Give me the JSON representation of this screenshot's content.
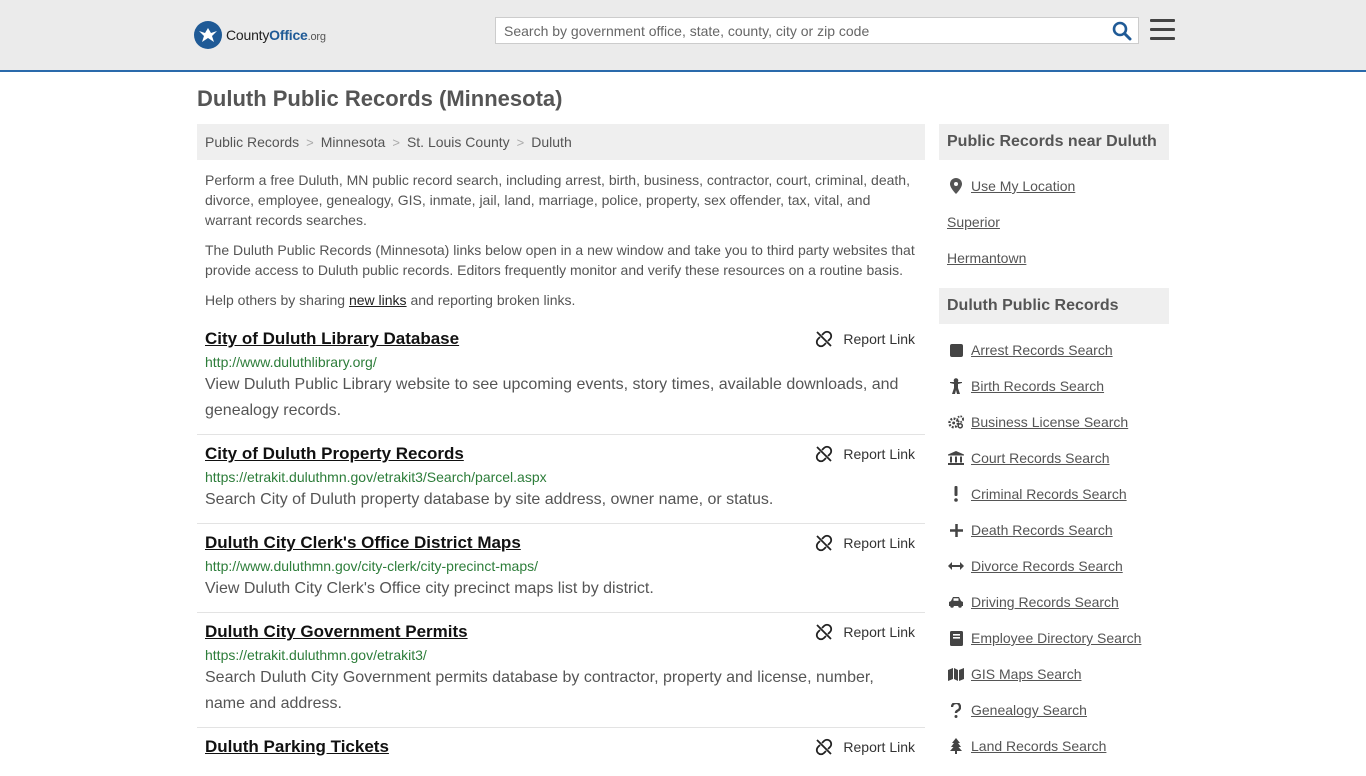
{
  "header": {
    "logo": {
      "county": "County",
      "office": "Office",
      "tld": ".org"
    },
    "search": {
      "placeholder": "Search by government office, state, county, city or zip code"
    }
  },
  "page": {
    "title": "Duluth Public Records (Minnesota)"
  },
  "breadcrumb": [
    "Public Records",
    "Minnesota",
    "St. Louis County",
    "Duluth"
  ],
  "intro": {
    "p1": "Perform a free Duluth, MN public record search, including arrest, birth, business, contractor, court, criminal, death, divorce, employee, genealogy, GIS, inmate, jail, land, marriage, police, property, sex offender, tax, vital, and warrant records searches.",
    "p2": "The Duluth Public Records (Minnesota) links below open in a new window and take you to third party websites that provide access to Duluth public records. Editors frequently monitor and verify these resources on a routine basis.",
    "p3_before": "Help others by sharing ",
    "p3_link": "new links",
    "p3_after": " and reporting broken links."
  },
  "report_label": "Report Link",
  "results": [
    {
      "title": "City of Duluth Library Database",
      "url": "http://www.duluthlibrary.org/",
      "desc": "View Duluth Public Library website to see upcoming events, story times, available downloads, and genealogy records."
    },
    {
      "title": "City of Duluth Property Records",
      "url": "https://etrakit.duluthmn.gov/etrakit3/Search/parcel.aspx",
      "desc": "Search City of Duluth property database by site address, owner name, or status."
    },
    {
      "title": "Duluth City Clerk's Office District Maps",
      "url": "http://www.duluthmn.gov/city-clerk/city-precinct-maps/",
      "desc": "View Duluth City Clerk's Office city precinct maps list by district."
    },
    {
      "title": "Duluth City Government Permits",
      "url": "https://etrakit.duluthmn.gov/etrakit3/",
      "desc": "Search Duluth City Government permits database by contractor, property and license, number, name and address."
    },
    {
      "title": "Duluth Parking Tickets",
      "url": "",
      "desc": ""
    }
  ],
  "sidebar": {
    "near": {
      "heading": "Public Records near Duluth",
      "use_location": "Use My Location",
      "cities": [
        "Superior",
        "Hermantown"
      ]
    },
    "records": {
      "heading": "Duluth Public Records",
      "items": [
        {
          "label": "Arrest Records Search",
          "icon": "arrest-icon"
        },
        {
          "label": "Birth Records Search",
          "icon": "birth-icon"
        },
        {
          "label": "Business License Search",
          "icon": "gears-icon"
        },
        {
          "label": "Court Records Search",
          "icon": "courthouse-icon"
        },
        {
          "label": "Criminal Records Search",
          "icon": "exclamation-icon"
        },
        {
          "label": "Death Records Search",
          "icon": "cross-icon"
        },
        {
          "label": "Divorce Records Search",
          "icon": "arrows-icon"
        },
        {
          "label": "Driving Records Search",
          "icon": "car-icon"
        },
        {
          "label": "Employee Directory Search",
          "icon": "book-icon"
        },
        {
          "label": "GIS Maps Search",
          "icon": "map-icon"
        },
        {
          "label": "Genealogy Search",
          "icon": "question-icon"
        },
        {
          "label": "Land Records Search",
          "icon": "tree-icon"
        }
      ]
    }
  }
}
